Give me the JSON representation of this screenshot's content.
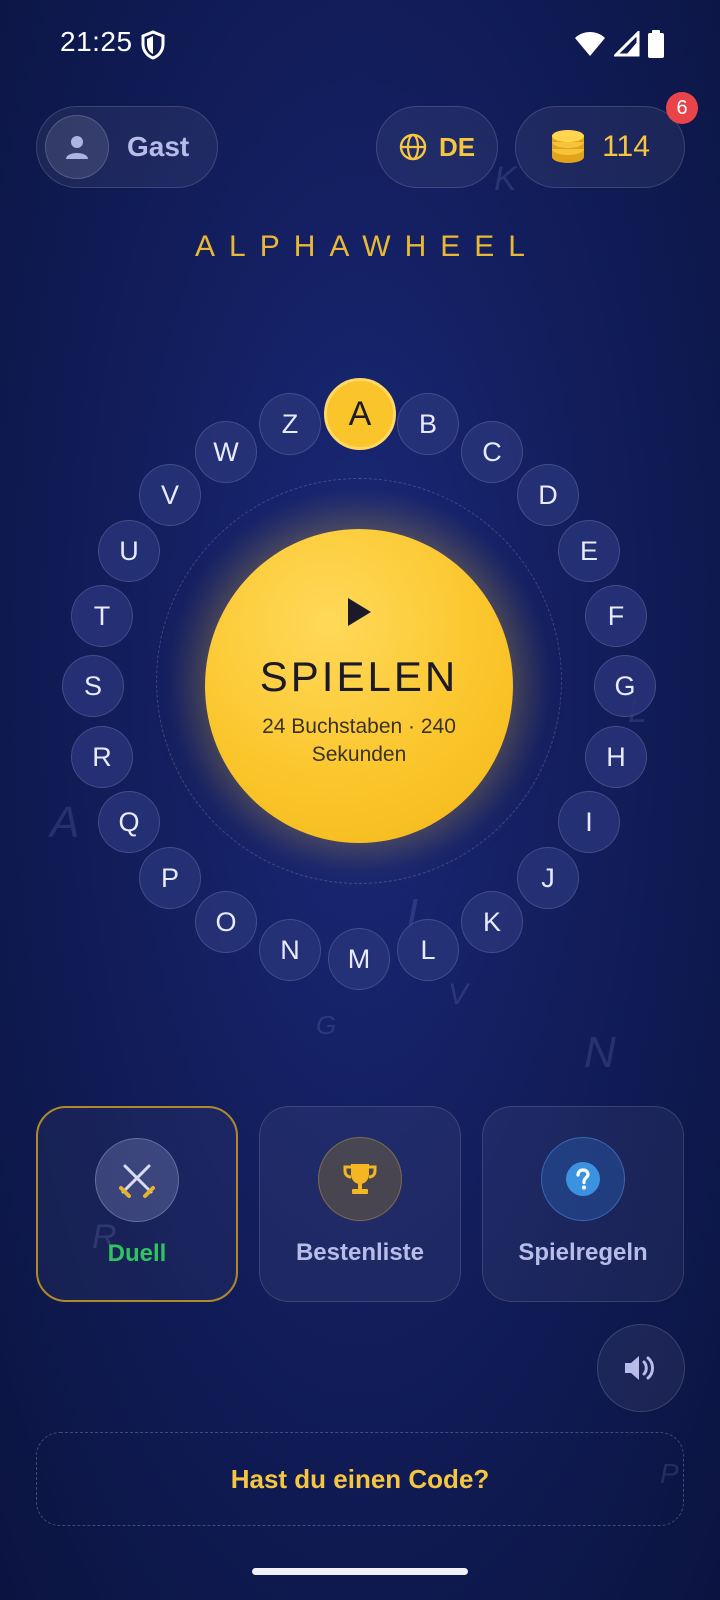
{
  "status_bar": {
    "time": "21:25"
  },
  "header": {
    "guest_label": "Gast",
    "language": "DE",
    "coins": "114",
    "notification_count": "6"
  },
  "app_title": "ALPHAWHEEL",
  "play": {
    "label": "SPIELEN",
    "subtitle": "24 Buchstaben · 240 Sekunden"
  },
  "wheel": {
    "active_letter": "A",
    "letters": [
      "A",
      "B",
      "C",
      "D",
      "E",
      "F",
      "G",
      "H",
      "I",
      "J",
      "K",
      "L",
      "M",
      "N",
      "O",
      "P",
      "Q",
      "R",
      "S",
      "T",
      "U",
      "V",
      "W",
      "Z"
    ]
  },
  "modes": [
    {
      "label": "Duell",
      "icon": "crossed-swords-icon",
      "selected": true
    },
    {
      "label": "Bestenliste",
      "icon": "trophy-icon",
      "selected": false
    },
    {
      "label": "Spielregeln",
      "icon": "question-icon",
      "selected": false
    }
  ],
  "code_prompt": "Hast du einen Code?",
  "colors": {
    "accent_gold": "#f9c52b",
    "background": "#142062",
    "badge_red": "#e9444a",
    "duel_green": "#2fc45e",
    "help_blue": "#3a92e0"
  }
}
